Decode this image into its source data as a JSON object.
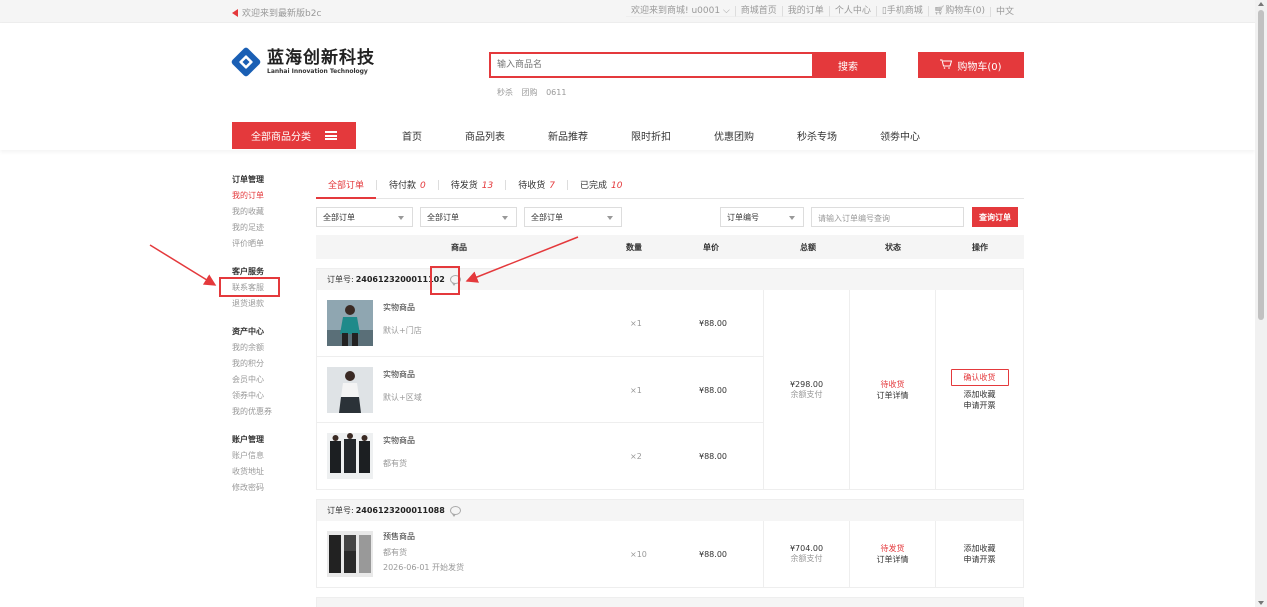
{
  "topbar": {
    "welcome": "欢迎来到最新版b2c",
    "greeting": "欢迎来到商城!",
    "user": "u0001",
    "links": [
      "商城首页",
      "我的订单",
      "个人中心",
      "手机商城",
      "购物车(0)",
      "中文"
    ]
  },
  "logo": {
    "cn": "蓝海创新科技",
    "en": "Lanhai Innovation Technology"
  },
  "search": {
    "placeholder": "输入商品名",
    "button": "搜索",
    "hotwords": [
      "秒杀",
      "团购",
      "0611"
    ]
  },
  "cart": {
    "label": "购物车(0)"
  },
  "nav": {
    "all_categories": "全部商品分类",
    "links": [
      "首页",
      "商品列表",
      "新品推荐",
      "限时折扣",
      "优惠团购",
      "秒杀专场",
      "领劵中心"
    ]
  },
  "sidebar": {
    "groups": [
      {
        "title": "订单管理",
        "items": [
          "我的订单",
          "我的收藏",
          "我的足迹",
          "评价晒单"
        ]
      },
      {
        "title": "客户服务",
        "items": [
          "联系客服",
          "退货退款"
        ]
      },
      {
        "title": "资产中心",
        "items": [
          "我的余额",
          "我的积分",
          "会员中心",
          "领券中心",
          "我的优惠券"
        ]
      },
      {
        "title": "账户管理",
        "items": [
          "账户信息",
          "收货地址",
          "修改密码"
        ]
      }
    ]
  },
  "tabs": [
    {
      "label": "全部订单",
      "count": ""
    },
    {
      "label": "待付款",
      "count": "0"
    },
    {
      "label": "待发货",
      "count": "13"
    },
    {
      "label": "待收货",
      "count": "7"
    },
    {
      "label": "已完成",
      "count": "10"
    }
  ],
  "filters": {
    "select1": "全部订单",
    "select2": "全部订单",
    "select3": "全部订单",
    "type": "订单编号",
    "placeholder": "请输入订单编号查询",
    "button": "查询订单"
  },
  "columns": [
    "商品",
    "数量",
    "单价",
    "总额",
    "状态",
    "操作"
  ],
  "orders": [
    {
      "label": "订单号:",
      "number": "2406123200011102",
      "items": [
        {
          "name": "实物商品",
          "attr": "默认+门店",
          "attr2": "",
          "qty": "×1",
          "price": "¥88.00"
        },
        {
          "name": "实物商品",
          "attr": "默认+区域",
          "attr2": "",
          "qty": "×1",
          "price": "¥88.00"
        },
        {
          "name": "实物商品",
          "attr": "都有货",
          "attr2": "",
          "qty": "×2",
          "price": "¥88.00"
        }
      ],
      "total": "¥298.00",
      "payment": "余额支付",
      "status": "待收货",
      "detail": "订单详情",
      "confirm": "确认收货",
      "favorite": "添加收藏",
      "invoice": "申请开票"
    },
    {
      "label": "订单号:",
      "number": "2406123200011088",
      "items": [
        {
          "name": "预售商品",
          "attr": "都有货",
          "attr2": "2026-06-01 开始发货",
          "qty": "×10",
          "price": "¥88.00"
        }
      ],
      "total": "¥704.00",
      "payment": "余额支付",
      "status": "待发货",
      "detail": "订单详情",
      "favorite": "添加收藏",
      "invoice": "申请开票"
    }
  ]
}
